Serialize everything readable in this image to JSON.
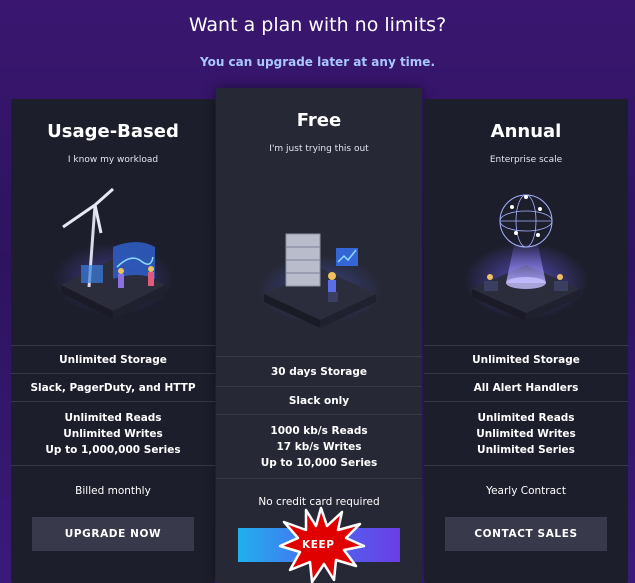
{
  "header": {
    "title": "Want a plan with no limits?",
    "subtitle": "You can upgrade later at any time."
  },
  "plans": {
    "usage": {
      "title": "Usage-Based",
      "tagline": "I know my workload",
      "features": [
        "Unlimited Storage",
        "Slack, PagerDuty, and HTTP",
        "Unlimited Reads\nUnlimited Writes\nUp to 1,000,000 Series"
      ],
      "billing": "Billed monthly",
      "button": "UPGRADE NOW"
    },
    "free": {
      "title": "Free",
      "tagline": "I'm just trying this out",
      "features": [
        "30 days Storage",
        "Slack only",
        "1000 kb/s Reads\n17 kb/s Writes\nUp to 10,000 Series"
      ],
      "billing": "No credit card required",
      "button": "KEEP"
    },
    "annual": {
      "title": "Annual",
      "tagline": "Enterprise scale",
      "features": [
        "Unlimited Storage",
        "All Alert Handlers",
        "Unlimited Reads\nUnlimited Writes\nUnlimited Series"
      ],
      "billing": "Yearly Contract",
      "button": "CONTACT SALES"
    }
  },
  "colors": {
    "background": "#3a1670",
    "card": "#1d1e2c",
    "card_featured": "#272836",
    "button_dark": "#383a4c",
    "button_gradient_start": "#20b0ee",
    "button_gradient_end": "#6a3ee6",
    "subtitle": "#a9c7ff",
    "highlight_burst": "#e00000"
  }
}
